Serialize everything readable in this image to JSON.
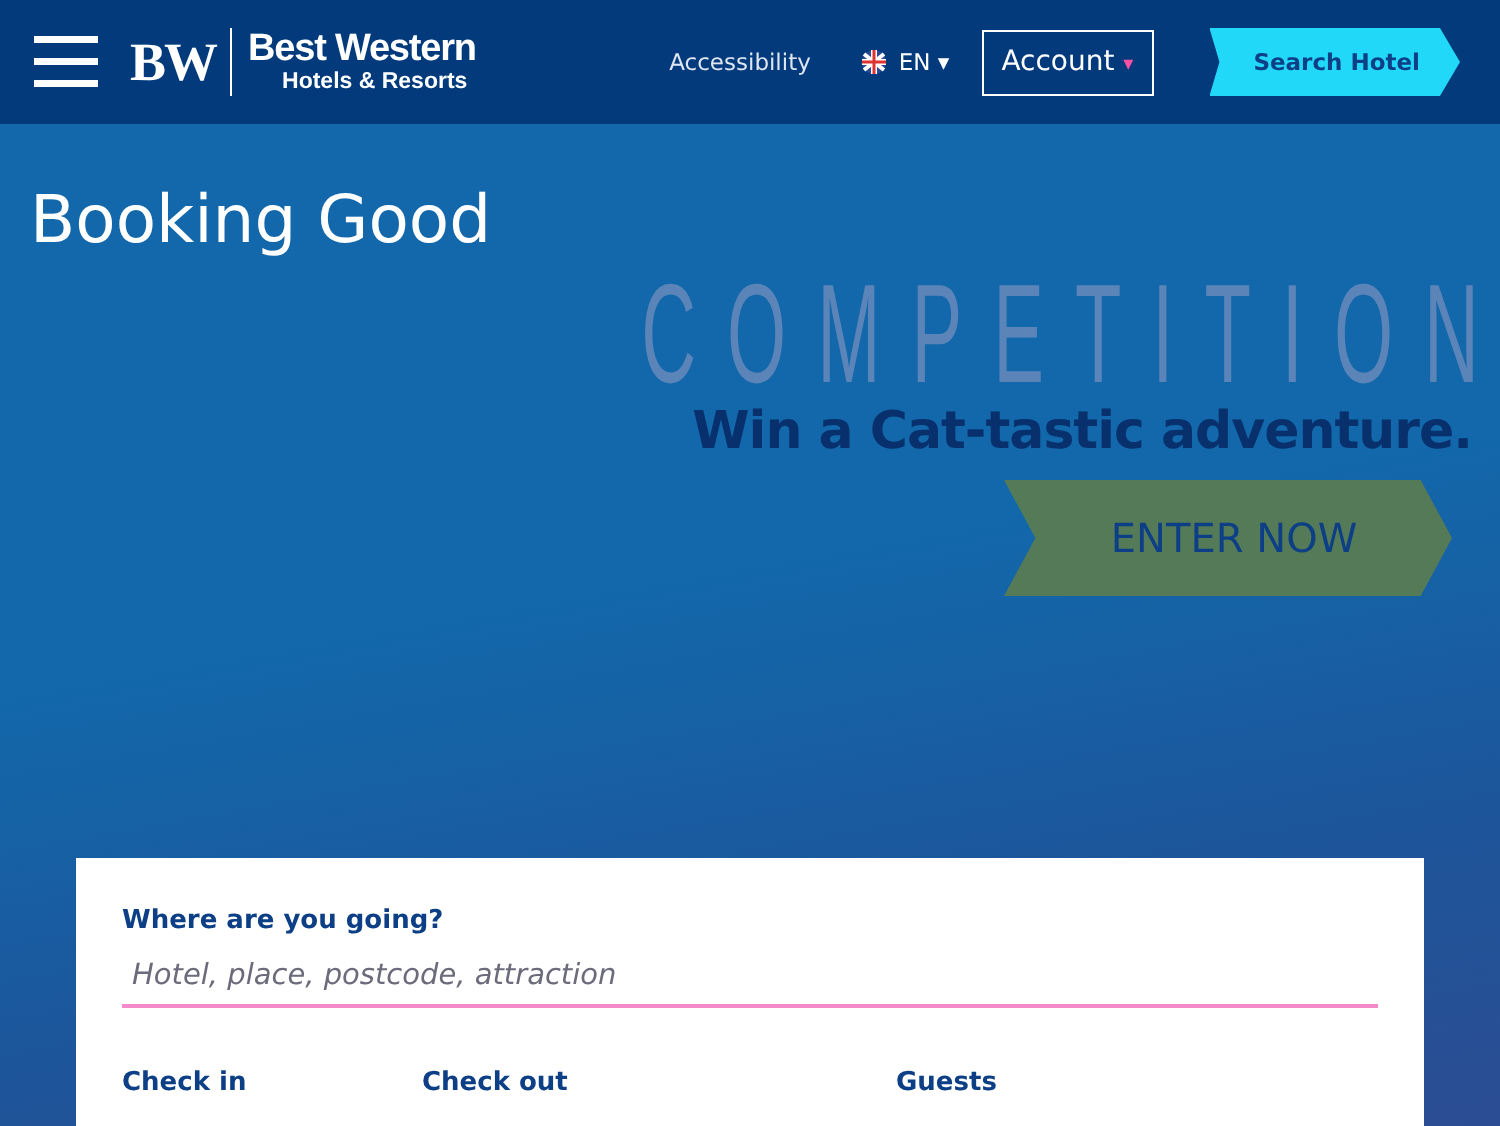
{
  "header": {
    "logo": {
      "mark": "BW",
      "name": "Best Western",
      "tagline": "Hotels & Resorts"
    },
    "accessibility": "Accessibility",
    "language": {
      "label": "EN",
      "caret": "▾"
    },
    "account": {
      "label": "Account",
      "caret": "▾"
    },
    "search_button": "Search Hotel"
  },
  "hero": {
    "title": "Booking Good",
    "promo": {
      "heading": "COMPETITION",
      "subheading": "Win a Cat-tastic adventure.",
      "button": "ENTER NOW"
    }
  },
  "search_form": {
    "destination": {
      "label": "Where are you going?",
      "placeholder": "Hotel, place, postcode, attraction"
    },
    "fields": [
      {
        "label": "Check in"
      },
      {
        "label": "Check out"
      },
      {
        "label": "Guests"
      }
    ]
  }
}
